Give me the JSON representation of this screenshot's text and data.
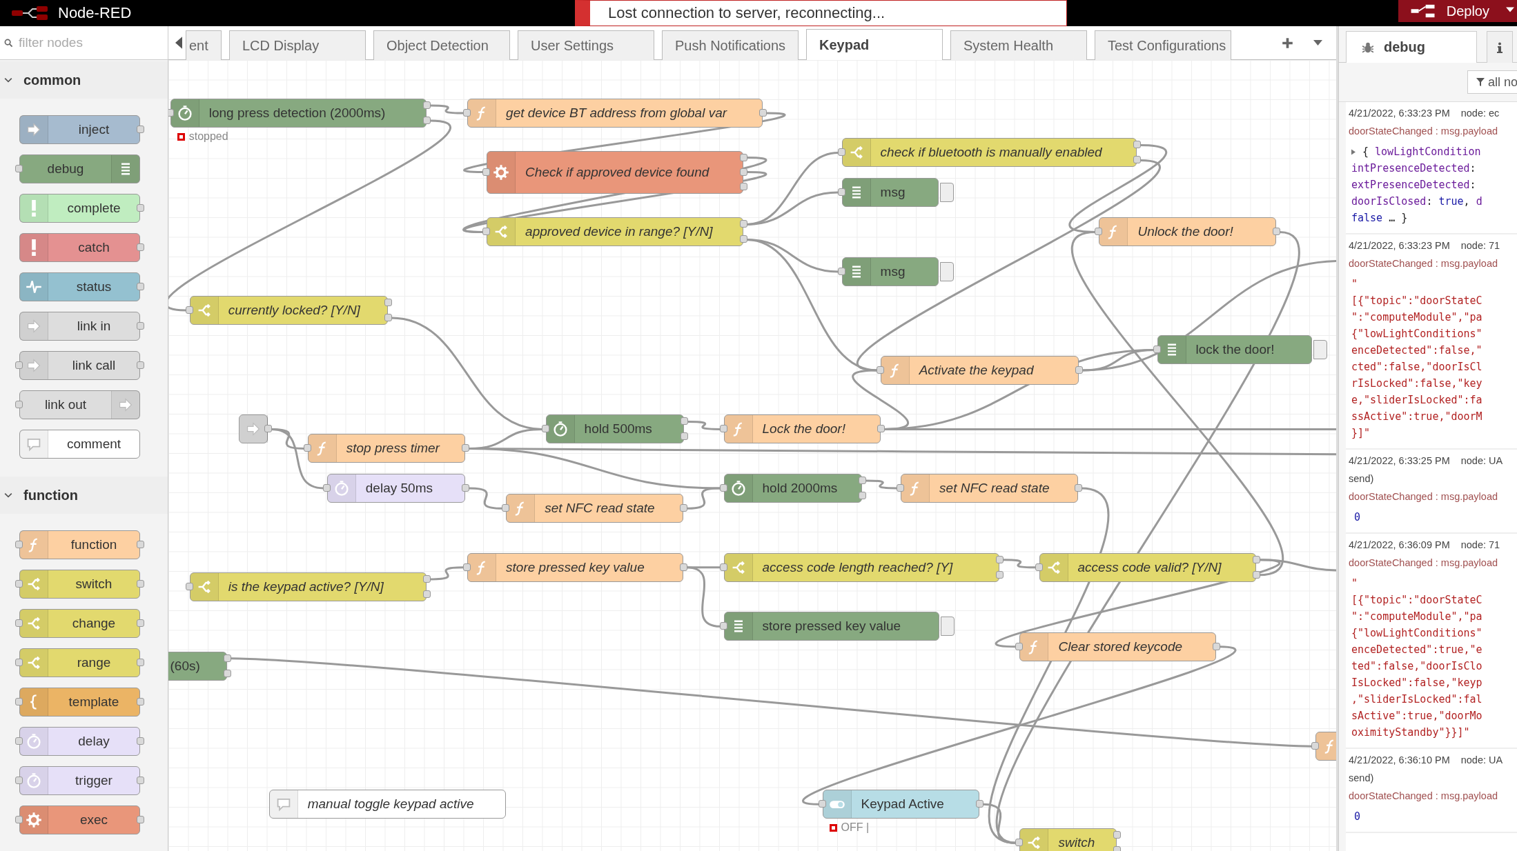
{
  "header": {
    "title": "Node-RED",
    "deploy": "Deploy"
  },
  "notification": {
    "text": "Lost connection to server, reconnecting..."
  },
  "palette": {
    "filter_placeholder": "filter nodes",
    "sections": [
      {
        "title": "common",
        "expanded": true,
        "items": [
          {
            "label": "inject",
            "kind": "inject",
            "input": false,
            "output": true
          },
          {
            "label": "debug",
            "kind": "debug",
            "input": true,
            "output": false
          },
          {
            "label": "complete",
            "kind": "complete",
            "input": false,
            "output": true
          },
          {
            "label": "catch",
            "kind": "catch",
            "input": false,
            "output": true
          },
          {
            "label": "status",
            "kind": "status",
            "input": false,
            "output": true
          },
          {
            "label": "link in",
            "kind": "linkin",
            "input": false,
            "output": true
          },
          {
            "label": "link call",
            "kind": "linkcall",
            "input": true,
            "output": true
          },
          {
            "label": "link out",
            "kind": "linkout",
            "input": true,
            "output": false
          },
          {
            "label": "comment",
            "kind": "comment",
            "input": false,
            "output": false
          }
        ]
      },
      {
        "title": "function",
        "expanded": true,
        "items": [
          {
            "label": "function",
            "kind": "function",
            "input": true,
            "output": true
          },
          {
            "label": "switch",
            "kind": "switch",
            "input": true,
            "output": true
          },
          {
            "label": "change",
            "kind": "change",
            "input": true,
            "output": true
          },
          {
            "label": "range",
            "kind": "range",
            "input": true,
            "output": true
          },
          {
            "label": "template",
            "kind": "template",
            "input": true,
            "output": true
          },
          {
            "label": "delay",
            "kind": "delay",
            "input": true,
            "output": true
          },
          {
            "label": "trigger",
            "kind": "trigger",
            "input": true,
            "output": true
          },
          {
            "label": "exec",
            "kind": "exec",
            "input": true,
            "output": true
          }
        ]
      }
    ]
  },
  "tabs": [
    {
      "label": "ent",
      "selected": false
    },
    {
      "label": "LCD Display",
      "selected": false
    },
    {
      "label": "Object Detection",
      "selected": false
    },
    {
      "label": "User Settings",
      "selected": false
    },
    {
      "label": "Push Notifications",
      "selected": false
    },
    {
      "label": "Keypad",
      "selected": true
    },
    {
      "label": "System Health",
      "selected": false
    },
    {
      "label": "Test Configurations",
      "selected": false
    }
  ],
  "nodes": [
    {
      "label": "long press detection (2000ms)",
      "kind": "timer",
      "status": "stopped"
    },
    {
      "label": "get device BT address from global var",
      "kind": "function"
    },
    {
      "label": "Check if approved device found",
      "kind": "exec"
    },
    {
      "label": "check if bluetooth is manually enabled",
      "kind": "switch"
    },
    {
      "label": "msg",
      "kind": "debug"
    },
    {
      "label": "approved device in range? [Y/N]",
      "kind": "switch"
    },
    {
      "label": "Unlock the door!",
      "kind": "function"
    },
    {
      "label": "msg",
      "kind": "debug"
    },
    {
      "label": "currently locked? [Y/N]",
      "kind": "switch"
    },
    {
      "label": "lock the door!",
      "kind": "debug"
    },
    {
      "label": "Activate the keypad",
      "kind": "function"
    },
    {
      "kind": "link"
    },
    {
      "label": "stop press timer",
      "kind": "function"
    },
    {
      "label": "hold 500ms",
      "kind": "timer"
    },
    {
      "label": "Lock the door!",
      "kind": "function"
    },
    {
      "label": "delay 50ms",
      "kind": "delay"
    },
    {
      "label": "hold 2000ms",
      "kind": "timer"
    },
    {
      "label": "set NFC read state",
      "kind": "function"
    },
    {
      "label": "set NFC read state",
      "kind": "function"
    },
    {
      "label": "store pressed key value",
      "kind": "function"
    },
    {
      "label": "is the keypad active? [Y/N]",
      "kind": "switch"
    },
    {
      "label": "access code length reached? [Y]",
      "kind": "switch"
    },
    {
      "label": "access code valid? [Y/N]",
      "kind": "switch"
    },
    {
      "label": "store pressed key value",
      "kind": "debug"
    },
    {
      "label": "Clear stored keycode",
      "kind": "function"
    },
    {
      "label": "(60s)",
      "kind": "timer"
    },
    {
      "label": "manual toggle keypad active",
      "kind": "comment"
    },
    {
      "label": "Keypad Active",
      "kind": "uiswitch",
      "status": "OFF |"
    },
    {
      "label": "switch",
      "kind": "switch"
    },
    {
      "kind": "function"
    }
  ],
  "sidebar": {
    "tabs": [
      {
        "label": "debug",
        "selected": true
      },
      {
        "kind": "info",
        "selected": false
      }
    ],
    "filter": "all no",
    "messages": [
      {
        "time": "4/21/2022, 6:33:23 PM",
        "node": "node: ec",
        "topic": "doorStateChanged : msg.payload",
        "kind": "object",
        "lines": [
          [
            {
              "text": "{ ",
              "kind": "punct"
            },
            {
              "text": "lowLightCondition",
              "kind": "key"
            }
          ],
          [
            {
              "text": "intPresenceDetected",
              "kind": "key"
            },
            {
              "text": ":",
              "kind": "punct"
            }
          ],
          [
            {
              "text": "extPresenceDetected",
              "kind": "key"
            },
            {
              "text": ":",
              "kind": "punct"
            }
          ],
          [
            {
              "text": "doorIsClosed",
              "kind": "key"
            },
            {
              "text": ": ",
              "kind": "punct"
            },
            {
              "text": "true",
              "kind": "value"
            },
            {
              "text": ", ",
              "kind": "punct"
            },
            {
              "text": "d",
              "kind": "key"
            }
          ],
          [
            {
              "text": "false",
              "kind": "value"
            },
            {
              "text": " … }",
              "kind": "punct"
            }
          ]
        ]
      },
      {
        "time": "4/21/2022, 6:33:23 PM",
        "node": "node: 71",
        "topic": "doorStateChanged : msg.payload",
        "kind": "string",
        "lines": [
          "\"",
          "[{\"topic\":\"doorStateC",
          "\":\"computeModule\",\"pa",
          "{\"lowLightConditions\"",
          "enceDetected\":false,\"",
          "cted\":false,\"doorIsCl",
          "rIsLocked\":false,\"key",
          "e,\"sliderIsLocked\":fa",
          "ssActive\":true,\"doorM",
          "}]\""
        ]
      },
      {
        "time": "4/21/2022, 6:33:25 PM",
        "node": "node: UA",
        "extra": "send)",
        "topic": "doorStateChanged : msg.payload",
        "kind": "number",
        "lines": [
          "0"
        ]
      },
      {
        "time": "4/21/2022, 6:36:09 PM",
        "node": "node: 71",
        "topic": "doorStateChanged : msg.payload",
        "kind": "string",
        "lines": [
          "\"",
          "[{\"topic\":\"doorStateC",
          "\":\"computeModule\",\"pa",
          "{\"lowLightConditions\"",
          "enceDetected\":true,\"e",
          "ted\":false,\"doorIsClo",
          "IsLocked\":false,\"keyp",
          ",\"sliderIsLocked\":fal",
          "sActive\":true,\"doorMo",
          "oximityStandby\"}}]\""
        ]
      },
      {
        "time": "4/21/2022, 6:36:10 PM",
        "node": "node: UA",
        "extra": "send)",
        "topic": "doorStateChanged : msg.payload",
        "kind": "number",
        "lines": [
          "0"
        ]
      }
    ]
  }
}
